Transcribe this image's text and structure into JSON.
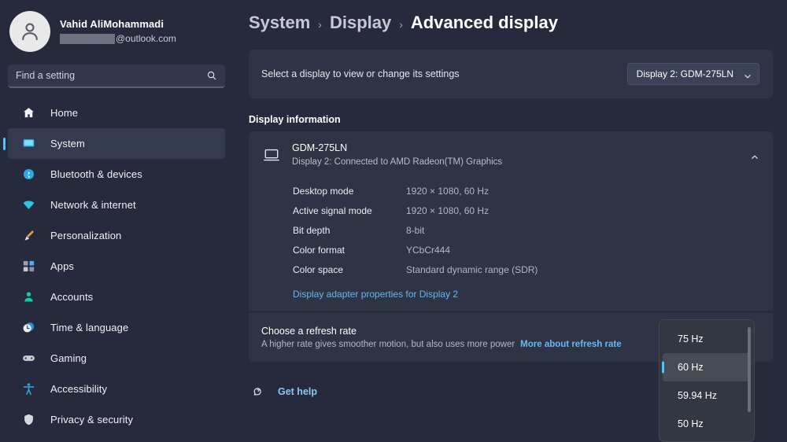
{
  "sidebar": {
    "profile": {
      "name": "Vahid AliMohammadi",
      "email_suffix": "@outlook.com",
      "avatar_icon": "person-avatar-icon"
    },
    "search": {
      "placeholder": "Find a setting",
      "icon": "search-icon"
    },
    "items": [
      {
        "label": "Home",
        "icon": "home-icon",
        "active": false
      },
      {
        "label": "System",
        "icon": "system-icon",
        "active": true
      },
      {
        "label": "Bluetooth & devices",
        "icon": "bluetooth-icon",
        "active": false
      },
      {
        "label": "Network & internet",
        "icon": "wifi-icon",
        "active": false
      },
      {
        "label": "Personalization",
        "icon": "brush-icon",
        "active": false
      },
      {
        "label": "Apps",
        "icon": "apps-icon",
        "active": false
      },
      {
        "label": "Accounts",
        "icon": "accounts-icon",
        "active": false
      },
      {
        "label": "Time & language",
        "icon": "clock-icon",
        "active": false
      },
      {
        "label": "Gaming",
        "icon": "gamepad-icon",
        "active": false
      },
      {
        "label": "Accessibility",
        "icon": "accessibility-icon",
        "active": false
      },
      {
        "label": "Privacy & security",
        "icon": "shield-icon",
        "active": false
      }
    ]
  },
  "breadcrumb": {
    "root": "System",
    "parent": "Display",
    "current": "Advanced display",
    "separator": "›"
  },
  "selector": {
    "label": "Select a display to view or change its settings",
    "value": "Display 2: GDM-275LN",
    "chevron_icon": "chevron-down-icon"
  },
  "display_information": {
    "section_title": "Display information",
    "monitor_name": "GDM-275LN",
    "monitor_subtitle": "Display 2: Connected to AMD Radeon(TM) Graphics",
    "monitor_icon": "monitor-icon",
    "collapse_icon": "chevron-up-icon",
    "specs": [
      {
        "key": "Desktop mode",
        "value": "1920 × 1080, 60 Hz"
      },
      {
        "key": "Active signal mode",
        "value": "1920 × 1080, 60 Hz"
      },
      {
        "key": "Bit depth",
        "value": "8-bit"
      },
      {
        "key": "Color format",
        "value": "YCbCr444"
      },
      {
        "key": "Color space",
        "value": "Standard dynamic range (SDR)"
      }
    ],
    "adapter_link": "Display adapter properties for Display 2"
  },
  "refresh_rate": {
    "title": "Choose a refresh rate",
    "description": "A higher rate gives smoother motion, but also uses more power",
    "link": "More about refresh rate"
  },
  "refresh_rate_dropdown": {
    "open": true,
    "options": [
      {
        "label": "75 Hz",
        "selected": false
      },
      {
        "label": "60 Hz",
        "selected": true
      },
      {
        "label": "59.94 Hz",
        "selected": false
      },
      {
        "label": "50 Hz",
        "selected": false
      }
    ]
  },
  "get_help": {
    "label": "Get help",
    "icon": "help-icon"
  },
  "colors": {
    "background": "#262a3c",
    "card": "#2e3345",
    "accent": "#4cc2ff",
    "link": "#68b7f0",
    "flyout": "#333741"
  }
}
